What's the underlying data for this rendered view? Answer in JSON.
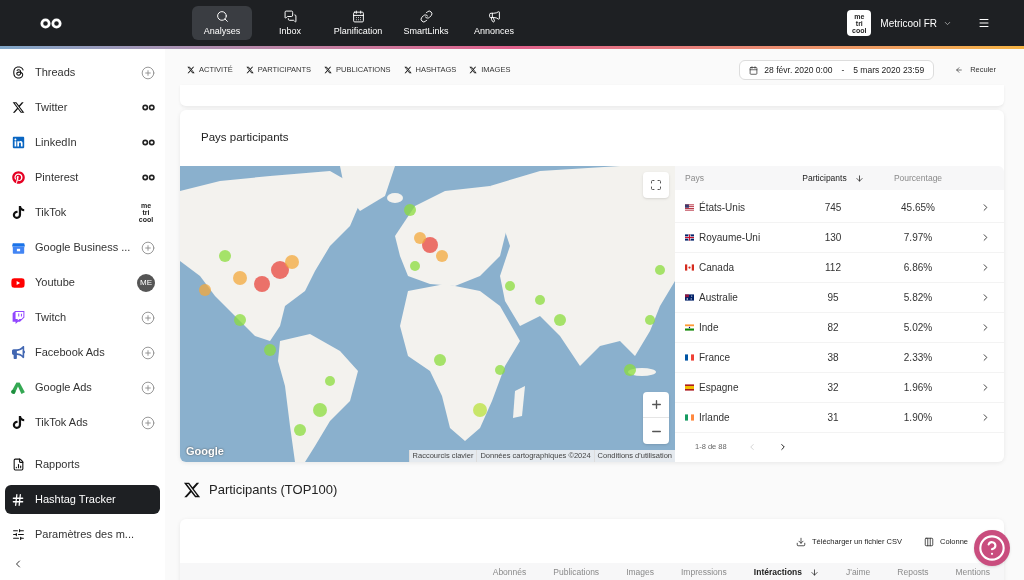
{
  "topbar": {
    "nav": [
      {
        "label": "Analyses",
        "selected": true
      },
      {
        "label": "Inbox",
        "selected": false
      },
      {
        "label": "Planification",
        "selected": false
      },
      {
        "label": "SmartLinks",
        "selected": false
      },
      {
        "label": "Annonces",
        "selected": false
      }
    ],
    "account": {
      "logo_text": [
        "me",
        "tri",
        "cool"
      ],
      "name": "Metricool FR"
    }
  },
  "sidebar": {
    "networks": [
      {
        "label": "Threads",
        "selected": false,
        "status": {
          "kind": "add"
        }
      },
      {
        "label": "Twitter",
        "selected": false,
        "status": {
          "kind": "connected"
        }
      },
      {
        "label": "LinkedIn",
        "selected": false,
        "status": {
          "kind": "connected"
        }
      },
      {
        "label": "Pinterest",
        "selected": false,
        "status": {
          "kind": "connected"
        }
      },
      {
        "label": "TikTok",
        "selected": false,
        "status": {
          "kind": "brand",
          "text": [
            "me",
            "tri",
            "cool"
          ]
        }
      },
      {
        "label": "Google Business ...",
        "selected": false,
        "status": {
          "kind": "add"
        }
      },
      {
        "label": "Youtube",
        "selected": false,
        "status": {
          "kind": "avatar",
          "text": "ME"
        }
      },
      {
        "label": "Twitch",
        "selected": false,
        "status": {
          "kind": "add"
        }
      },
      {
        "label": "Facebook Ads",
        "selected": false,
        "status": {
          "kind": "add"
        }
      },
      {
        "label": "Google Ads",
        "selected": false,
        "status": {
          "kind": "add"
        }
      },
      {
        "label": "TikTok Ads",
        "selected": false,
        "status": {
          "kind": "add"
        }
      }
    ],
    "tools": [
      {
        "label": "Rapports",
        "selected": false
      },
      {
        "label": "Hashtag Tracker",
        "selected": true
      },
      {
        "label": "Paramètres des m...",
        "selected": false
      }
    ]
  },
  "filters": {
    "tabs": [
      "ACTIVITÉ",
      "PARTICIPANTS",
      "PUBLICATIONS",
      "HASHTAGS",
      "IMAGES"
    ],
    "date_range": {
      "start": "28 févr. 2020 0:00",
      "separator": "-",
      "end": "5 mars 2020 23:59"
    },
    "back_button": "Reculer"
  },
  "countries_card": {
    "title": "Pays participants",
    "map": {
      "logo": "Google",
      "attribution": [
        "Raccourcis clavier",
        "Données cartographiques ©2024",
        "Conditions d'utilisation"
      ]
    },
    "table": {
      "columns": [
        {
          "label": "Pays",
          "sorted": false
        },
        {
          "label": "Participants",
          "sorted": true
        },
        {
          "label": "Pourcentage",
          "sorted": false
        }
      ],
      "rows": [
        {
          "country": "États-Unis",
          "participants": "745",
          "percentage": "45.65%"
        },
        {
          "country": "Royaume-Uni",
          "participants": "130",
          "percentage": "7.97%"
        },
        {
          "country": "Canada",
          "participants": "112",
          "percentage": "6.86%"
        },
        {
          "country": "Australie",
          "participants": "95",
          "percentage": "5.82%"
        },
        {
          "country": "Inde",
          "participants": "82",
          "percentage": "5.02%"
        },
        {
          "country": "France",
          "participants": "38",
          "percentage": "2.33%"
        },
        {
          "country": "Espagne",
          "participants": "32",
          "percentage": "1.96%"
        },
        {
          "country": "Irlande",
          "participants": "31",
          "percentage": "1.90%"
        }
      ],
      "pagination": {
        "range": "1-8 de 88",
        "prev": {
          "disabled": true
        },
        "next": {
          "disabled": false
        }
      }
    }
  },
  "participants_section": {
    "title": "Participants (TOP100)",
    "actions": [
      "Télécharger un fichier CSV",
      "Colonne"
    ],
    "columns": [
      {
        "label": "Abonnés",
        "sorted": false
      },
      {
        "label": "Publications",
        "sorted": false
      },
      {
        "label": "Images",
        "sorted": false
      },
      {
        "label": "Impressions",
        "sorted": false
      },
      {
        "label": "Intéractions",
        "sorted": true
      },
      {
        "label": "J'aime",
        "sorted": false
      },
      {
        "label": "Reposts",
        "sorted": false
      },
      {
        "label": "Mentions",
        "sorted": false
      }
    ]
  }
}
